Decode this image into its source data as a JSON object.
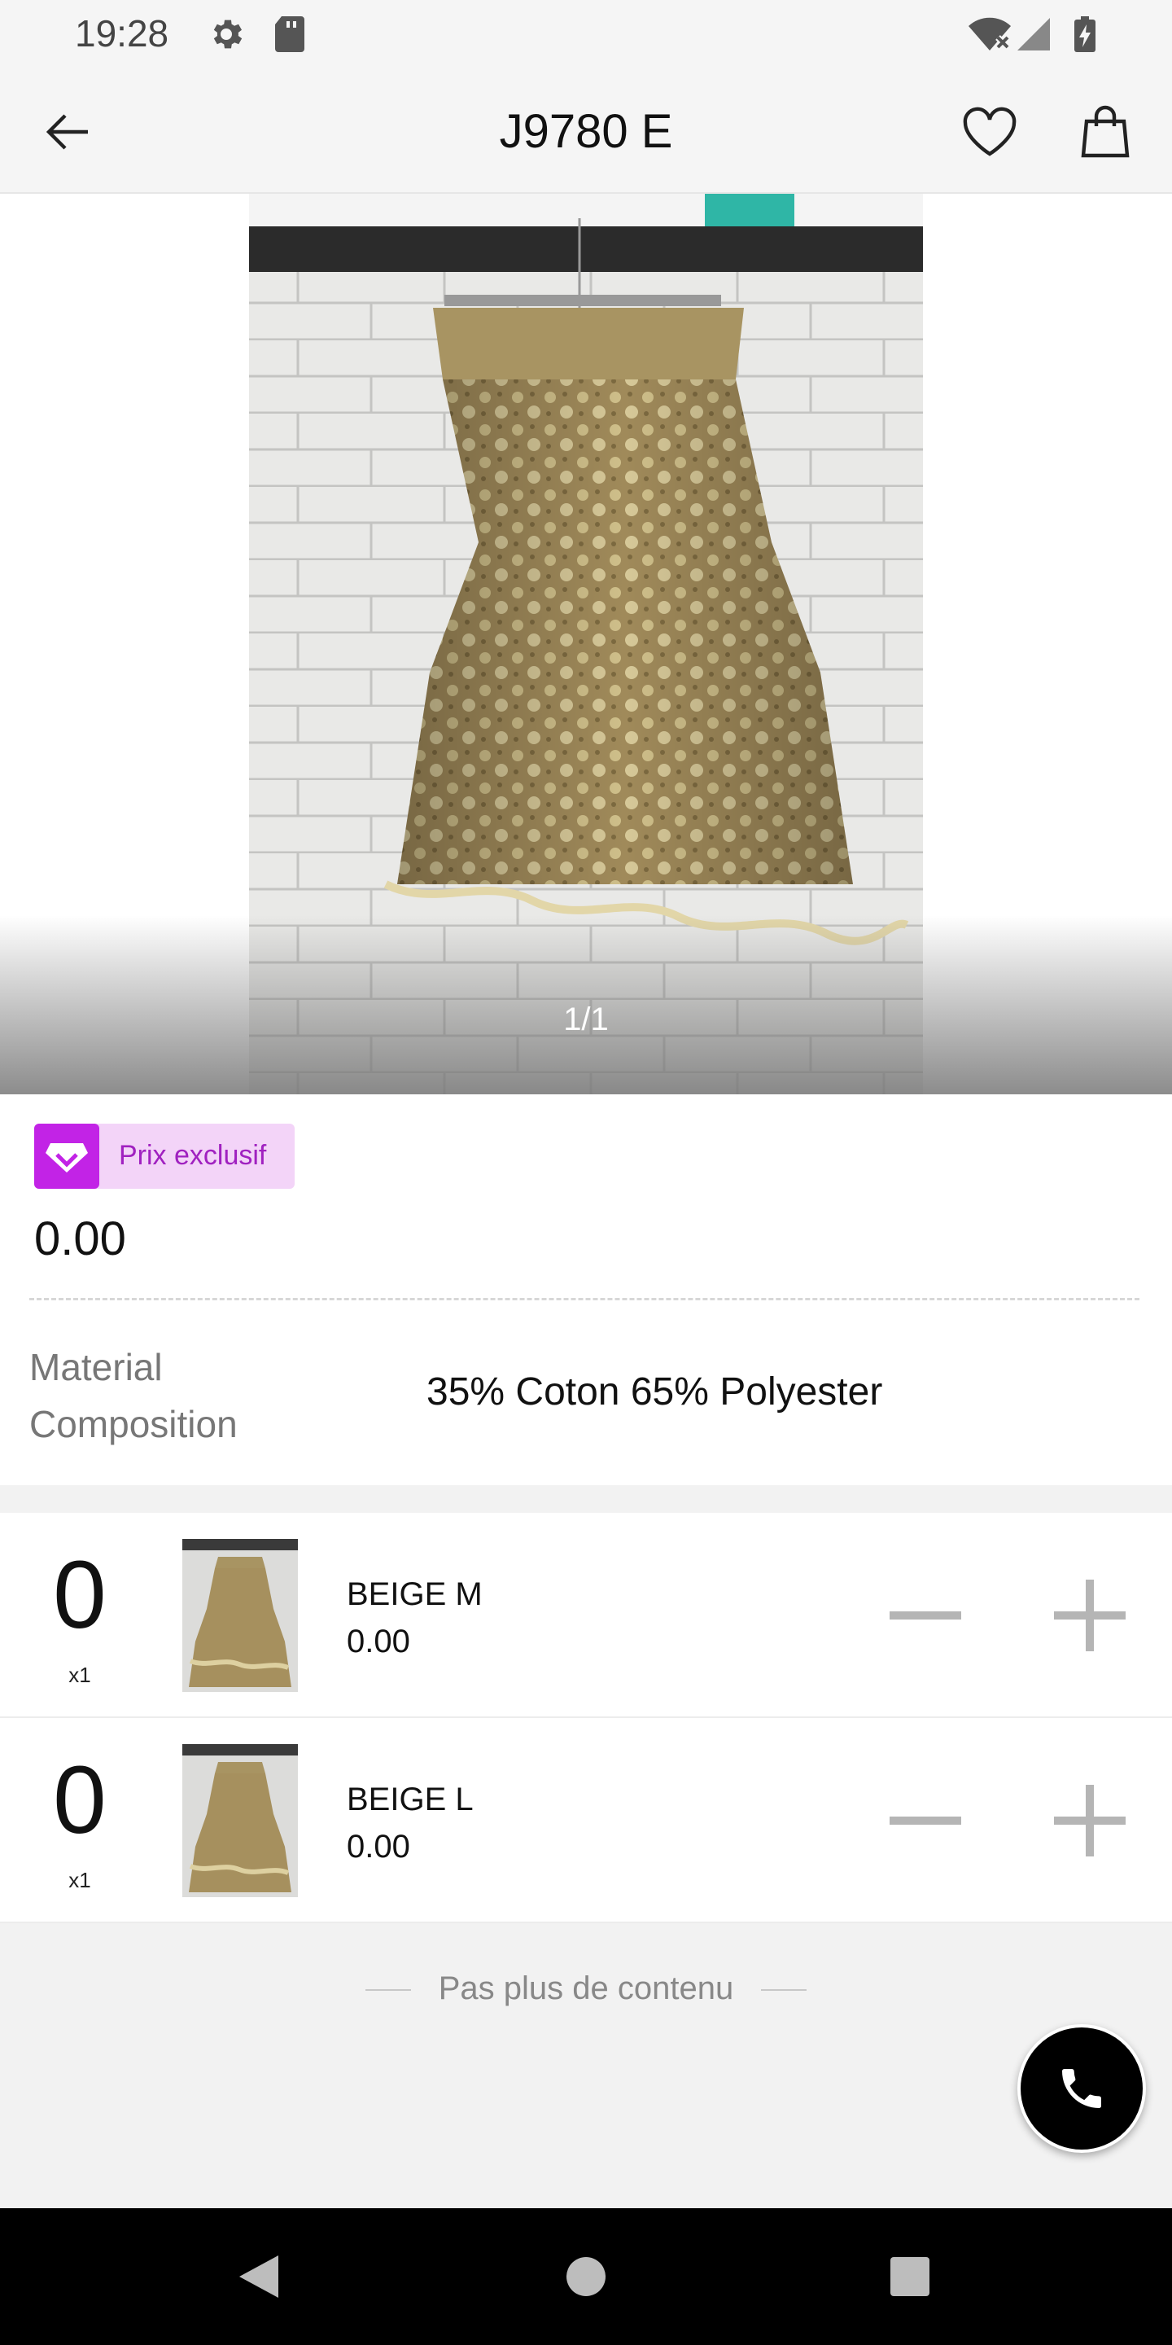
{
  "status_bar": {
    "time": "19:28",
    "icons": [
      "gear-icon",
      "sd-card-icon",
      "wifi-icon",
      "signal-icon",
      "battery-charging-icon"
    ]
  },
  "app_bar": {
    "title": "J9780 E",
    "back_icon": "arrow-left-icon",
    "favorite_icon": "heart-icon",
    "cart_icon": "shopping-bag-icon"
  },
  "gallery": {
    "counter": "1/1",
    "image": "gold lace tiered skirt on hanger"
  },
  "product": {
    "badge_label": "Prix exclusif",
    "badge_icon": "diamond-icon",
    "price": "0.00",
    "attributes": [
      {
        "label": "Material Composition",
        "value": "35% Coton 65% Polyester"
      }
    ]
  },
  "variants": [
    {
      "quantity": "0",
      "multiplier": "x1",
      "name": "BEIGE M",
      "price": "0.00"
    },
    {
      "quantity": "0",
      "multiplier": "x1",
      "name": "BEIGE L",
      "price": "0.00"
    }
  ],
  "footer": {
    "end_text": "Pas plus de contenu"
  },
  "fab": {
    "icon": "phone-icon"
  },
  "colors": {
    "accent": "#c223e6",
    "badge_bg": "#f3d4f8",
    "badge_text": "#a021c0"
  }
}
